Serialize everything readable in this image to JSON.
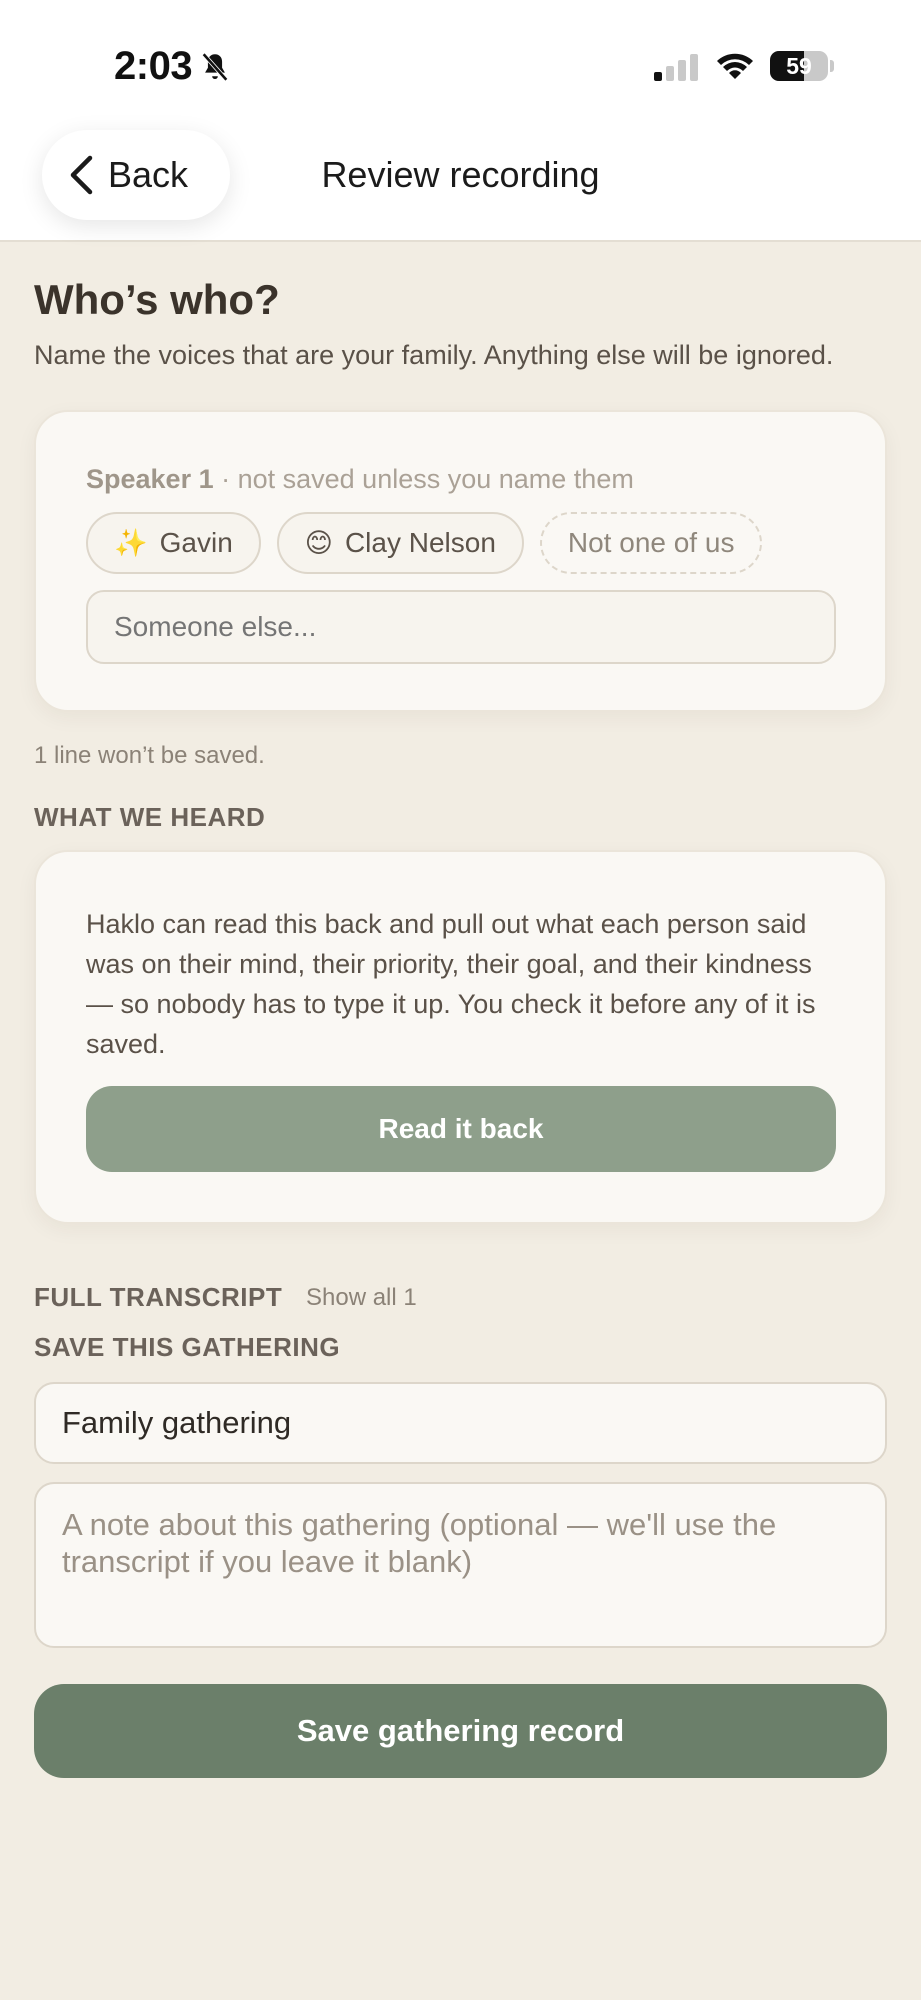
{
  "status_bar": {
    "time": "2:03",
    "battery": "59",
    "battery_fraction": 0.59
  },
  "nav": {
    "back_label": "Back",
    "title": "Review recording"
  },
  "whos_who": {
    "heading": "Who’s who?",
    "subtitle": "Name the voices that are your family. Anything else will be ignored."
  },
  "speaker_card": {
    "speaker_name": "Speaker 1",
    "speaker_note": " · not saved unless you name them",
    "chips": [
      {
        "emoji": "✨",
        "label": "Gavin"
      },
      {
        "emoji": "😊",
        "label": "Clay Nelson"
      },
      {
        "emoji": "",
        "label": "Not one of us"
      }
    ],
    "someone_placeholder": "Someone else..."
  },
  "unsaved_note": "1 line won’t be saved.",
  "heard": {
    "label": "WHAT WE HEARD",
    "text": "Haklo can read this back and pull out what each person said was on their mind, their priority, their goal, and their kindness — so nobody has to type it up. You check it before any of it is saved.",
    "button": "Read it back"
  },
  "transcript": {
    "label": "FULL TRANSCRIPT",
    "show_all": "Show all 1"
  },
  "save": {
    "label": "SAVE THIS GATHERING",
    "title_value": "Family gathering",
    "note_placeholder": "A note about this gathering (optional — we'll use the transcript if you leave it blank)",
    "button": "Save gathering record"
  },
  "colors": {
    "background": "#f2ede3",
    "accent_muted": "#8e9f8b",
    "accent_primary": "#6b7f6a"
  }
}
